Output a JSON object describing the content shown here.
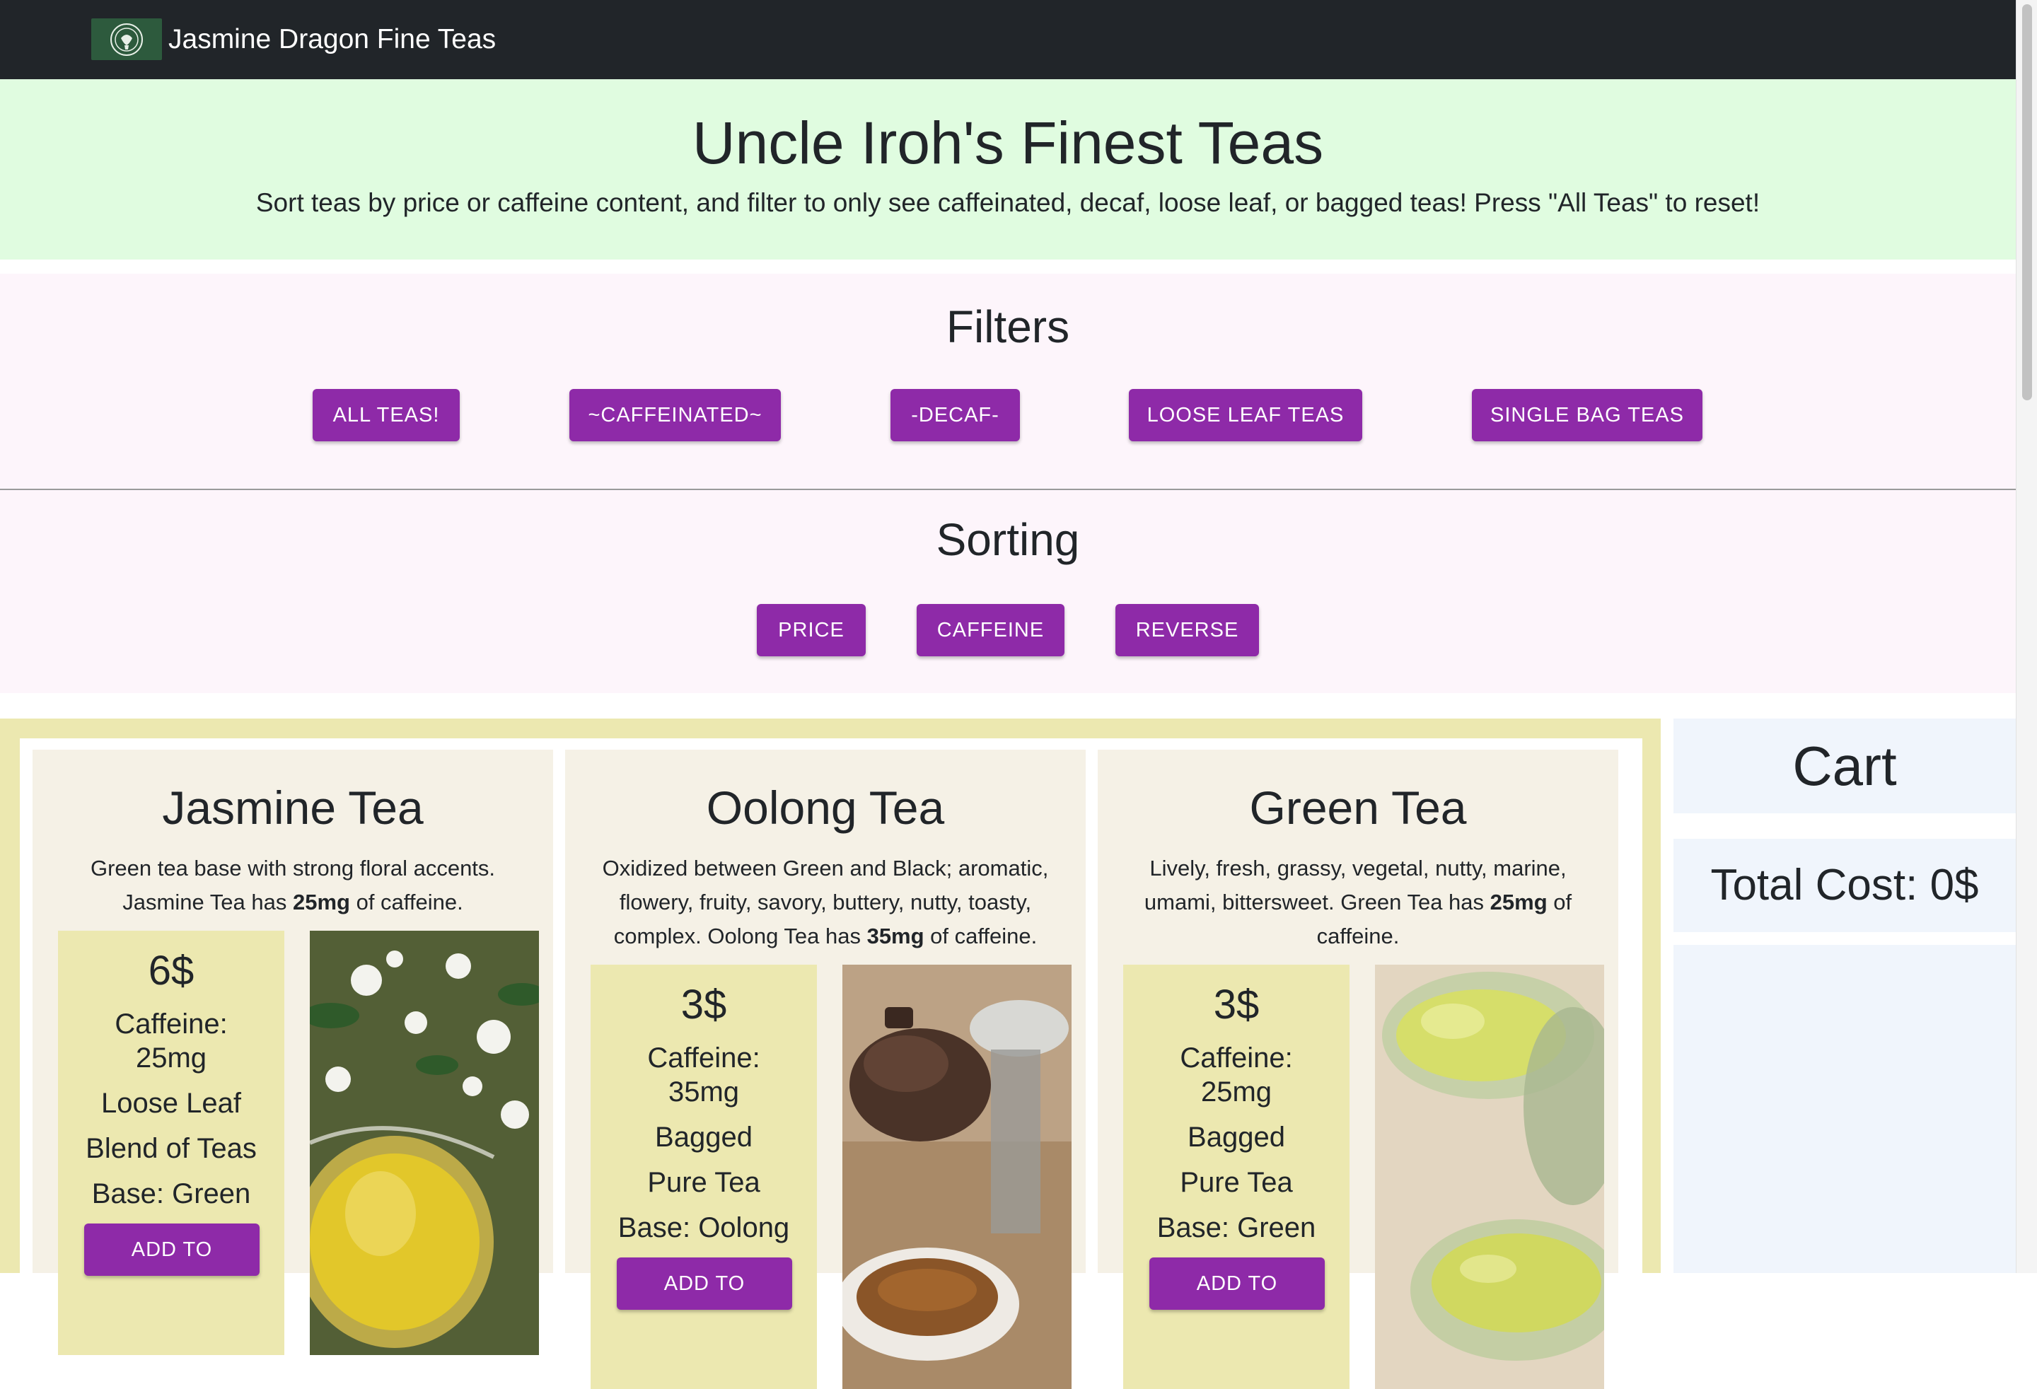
{
  "navbar": {
    "brand_text": "Jasmine Dragon Fine Teas",
    "logo_icon": "jasmine-dragon-logo"
  },
  "hero": {
    "title": "Uncle Iroh's Finest Teas",
    "subtitle": "Sort teas by price or caffeine content, and filter to only see caffeinated, decaf, loose leaf, or bagged teas! Press \"All Teas\" to reset!"
  },
  "filters": {
    "title": "Filters",
    "buttons": [
      "ALL TEAS!",
      "~CAFFEINATED~",
      "-DECAF-",
      "LOOSE LEAF TEAS",
      "SINGLE BAG TEAS"
    ]
  },
  "sorting": {
    "title": "Sorting",
    "buttons": [
      "PRICE",
      "CAFFEINE",
      "REVERSE"
    ]
  },
  "teas": [
    {
      "name": "Jasmine Tea",
      "desc_pre": "Green tea base with strong floral accents. Jasmine Tea has ",
      "desc_bold": "25mg",
      "desc_post": " of caffeine.",
      "price": "6$",
      "caffeine_label": "Caffeine:",
      "caffeine": "25mg",
      "form": "Loose Leaf",
      "blend": "Blend of Teas",
      "base": "Base: Green",
      "button": "ADD TO"
    },
    {
      "name": "Oolong Tea",
      "desc_pre": "Oxidized between Green and Black; aromatic, flowery, fruity, savory, buttery, nutty, toasty, complex. Oolong Tea has ",
      "desc_bold": "35mg",
      "desc_post": " of caffeine.",
      "price": "3$",
      "caffeine_label": "Caffeine:",
      "caffeine": "35mg",
      "form": "Bagged",
      "blend": "Pure Tea",
      "base": "Base: Oolong",
      "button": "ADD TO"
    },
    {
      "name": "Green Tea",
      "desc_pre": "Lively, fresh, grassy, vegetal, nutty, marine, umami, bittersweet. Green Tea has ",
      "desc_bold": "25mg",
      "desc_post": " of caffeine.",
      "price": "3$",
      "caffeine_label": "Caffeine:",
      "caffeine": "25mg",
      "form": "Bagged",
      "blend": "Pure Tea",
      "base": "Base: Green",
      "button": "ADD TO"
    }
  ],
  "cart": {
    "title": "Cart",
    "total": "Total Cost: 0$"
  },
  "colors": {
    "navbar": "#212529",
    "hero_bg": "#e0fce0",
    "filters_bg": "#fdf5fb",
    "button": "#8e2aa8",
    "product_bg": "#ece8b0",
    "card_bg": "#f5f1e6",
    "cart_bg": "#f0f5fc"
  }
}
